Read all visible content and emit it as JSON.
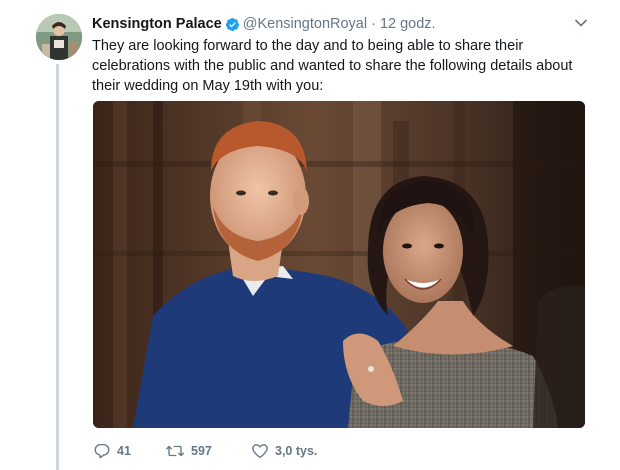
{
  "tweet": {
    "author": {
      "name": "Kensington Palace",
      "handle": "@KensingtonRoyal",
      "verified": true,
      "avatar_icon": "avatar-photo"
    },
    "separator": "·",
    "timestamp": "12 godz.",
    "text": "They are looking forward to the day and to being able to share their celebrations with the public and wanted to share the following details about their wedding on May 19th with you:",
    "media": {
      "type": "photo",
      "icon": "photo-couple"
    },
    "actions": {
      "reply": {
        "icon": "reply-icon",
        "count": "41"
      },
      "retweet": {
        "icon": "retweet-icon",
        "count": "597"
      },
      "like": {
        "icon": "heart-icon",
        "count": "3,0 tys."
      }
    },
    "menu_icon": "chevron-down-icon"
  },
  "colors": {
    "text_primary": "#14171a",
    "text_secondary": "#657786",
    "verified_blue": "#1da1f2",
    "thread_line": "#ccd6dd"
  }
}
